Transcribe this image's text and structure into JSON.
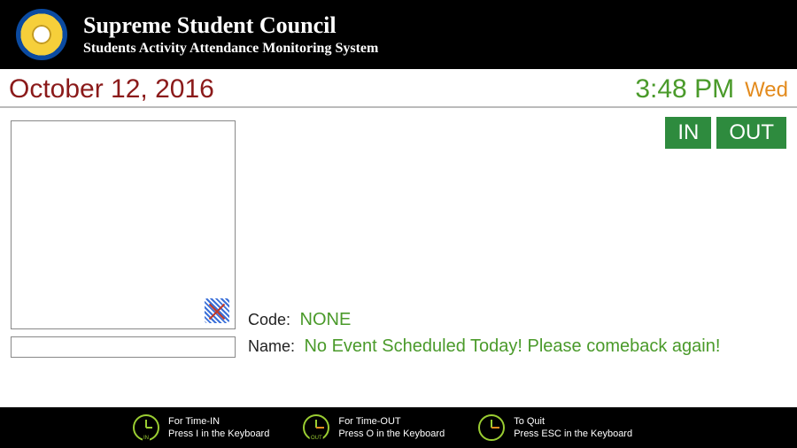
{
  "header": {
    "title": "Supreme Student Council",
    "subtitle": "Students Activity Attendance  Monitoring System"
  },
  "datebar": {
    "date": "October 12, 2016",
    "time": "3:48 PM",
    "day": "Wed"
  },
  "buttons": {
    "in_label": "IN",
    "out_label": "OUT"
  },
  "event": {
    "code_label": "Code:",
    "code_value": "NONE",
    "name_label": "Name:",
    "name_value": "No Event Scheduled Today! Please comeback again!"
  },
  "input": {
    "value": ""
  },
  "hints": {
    "in": {
      "title": "For Time-IN",
      "sub": "Press I in the Keyboard",
      "tag": "IN"
    },
    "out": {
      "title": "For Time-OUT",
      "sub": "Press O in the Keyboard",
      "tag": "OUT"
    },
    "quit": {
      "title": "To Quit",
      "sub": "Press ESC in the Keyboard",
      "tag": ""
    }
  },
  "colors": {
    "accent_green": "#4a9a2a",
    "date_red": "#8b1a1a",
    "day_orange": "#e38b1e",
    "button_green": "#2e8b3e"
  }
}
